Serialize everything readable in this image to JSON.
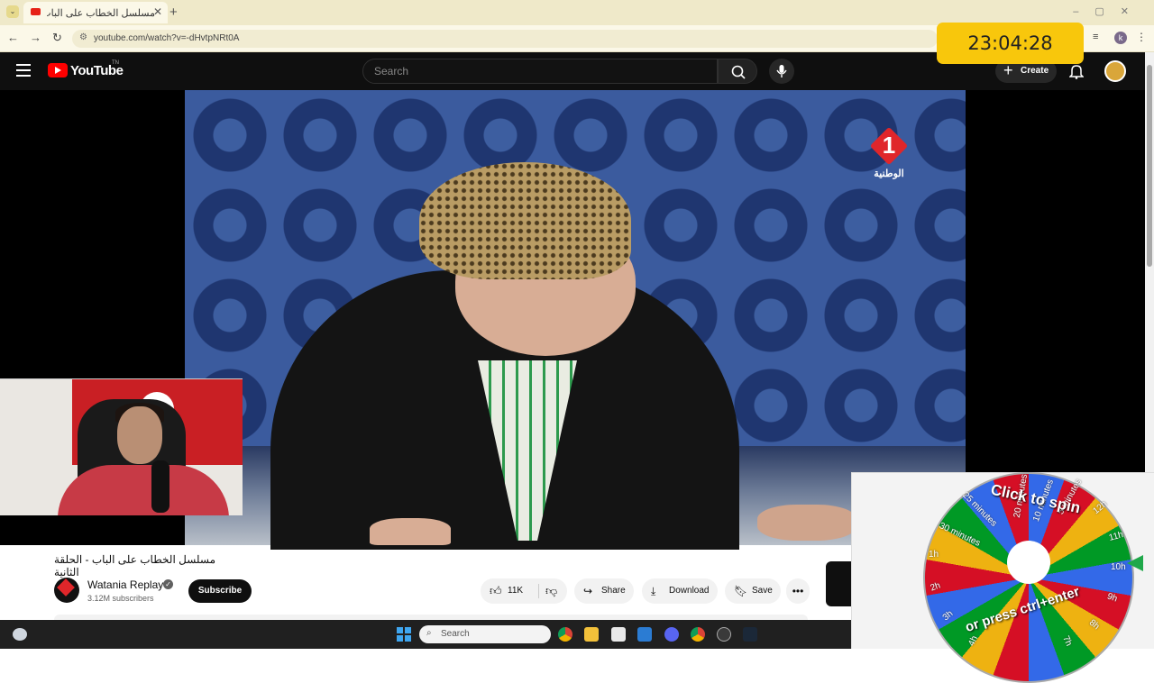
{
  "browser": {
    "tab_title": "مسلسل الخطاب على الباب - الحلقة الثانية",
    "url": "youtube.com/watch?v=-dHvtpNRt0A",
    "profile_initial": "k"
  },
  "youtube": {
    "logo_text": "YouTube",
    "logo_tm": "TN",
    "search_placeholder": "Search",
    "create_label": "Create"
  },
  "video": {
    "tv_logo_number": "1",
    "tv_logo_text": "الوطنية",
    "title": "مسلسل الخطاب على الباب - الحلقة الثانية",
    "channel_name": "Watania Replay",
    "subscribers": "3.12M subscribers",
    "subscribe_label": "Subscribe",
    "likes": "11K",
    "share_label": "Share",
    "download_label": "Download",
    "save_label": "Save"
  },
  "overlay": {
    "clock": "23:04:28",
    "wheel_spin_text": "Click to spin",
    "wheel_ctrl_text": "or press ctrl+enter",
    "wheel_labels": [
      "20 minutes",
      "10 minutes",
      "12h",
      "11h",
      "10h",
      "9h",
      "8h",
      "7h",
      "4h",
      "3h",
      "2h",
      "1h",
      "30 minutes",
      "25 minutes",
      "5 minutes"
    ]
  },
  "taskbar": {
    "search_placeholder": "Search"
  },
  "colors": {
    "youtube_red": "#ff0000",
    "clock_yellow": "#f8c70c",
    "wheel_blue": "#3369e8",
    "wheel_red": "#d50f25",
    "wheel_yellow": "#eeb211",
    "wheel_green": "#009925"
  }
}
